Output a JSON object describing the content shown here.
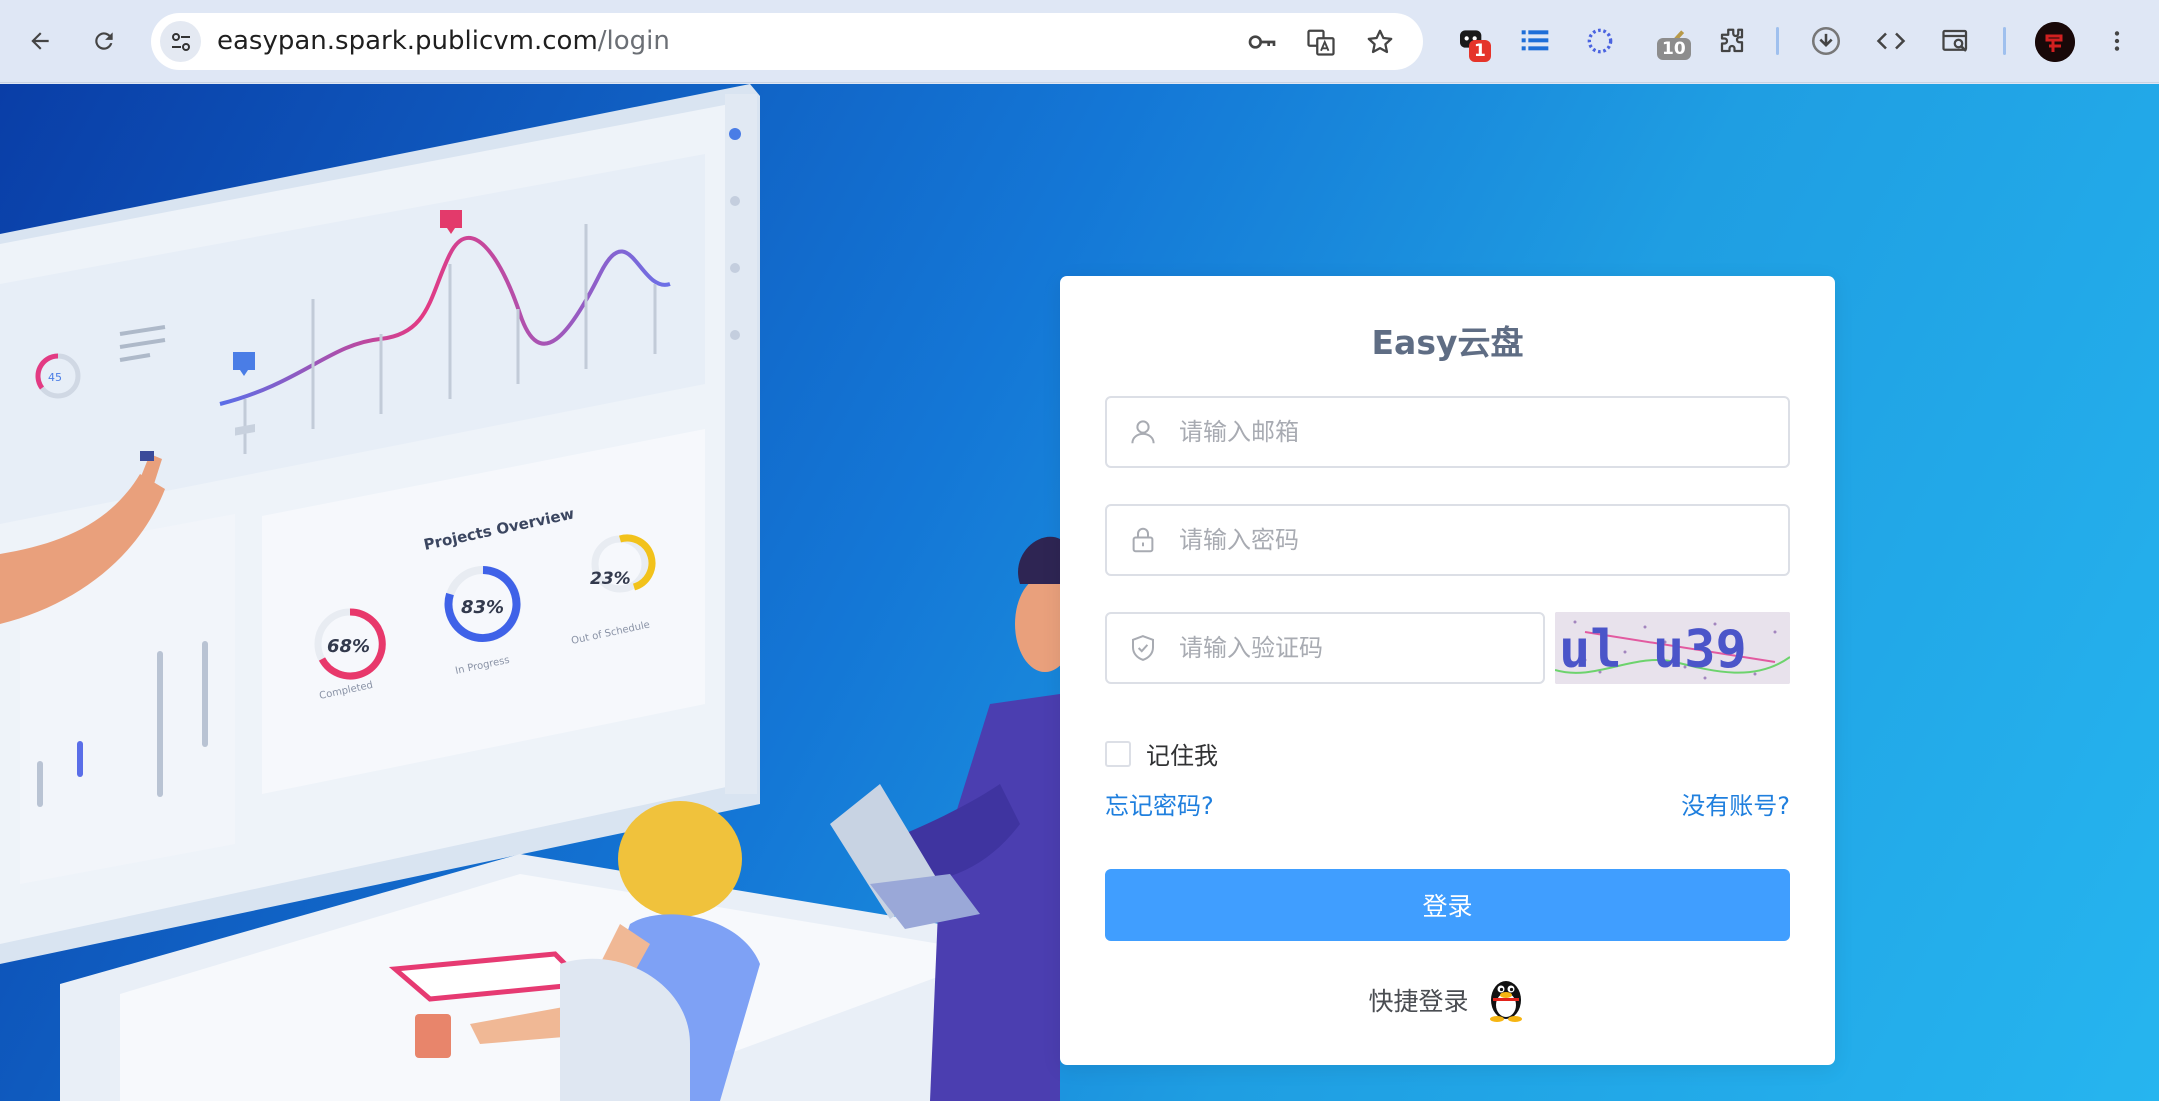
{
  "browser": {
    "url_host": "easypan.spark.publicvm.com",
    "url_path": "/login",
    "extensions": [
      {
        "name": "ext-chat",
        "badge": "1",
        "badge_color": "#e5342a"
      },
      {
        "name": "ext-list"
      },
      {
        "name": "ext-circle"
      },
      {
        "name": "ext-check",
        "badge": "10",
        "badge_color": "#8d8d8d"
      },
      {
        "name": "ext-puzzle"
      }
    ]
  },
  "illustration": {
    "gauge_small": "45",
    "projects_title": "Projects Overview",
    "stats": [
      {
        "value": "68%",
        "label": "Completed",
        "color": "#e8386b",
        "progress": 0.68
      },
      {
        "value": "83%",
        "label": "In Progress",
        "color": "#3f62e8",
        "progress": 0.83
      },
      {
        "value": "23%",
        "label": "Out of Schedule",
        "color": "#f2c21b",
        "progress": 0.23
      }
    ]
  },
  "login": {
    "title": "Easy云盘",
    "email_placeholder": "请输入邮箱",
    "password_placeholder": "请输入密码",
    "captcha_placeholder": "请输入验证码",
    "captcha_text": "ul u39",
    "remember_label": "记住我",
    "forgot_link": "忘记密码?",
    "register_link": "没有账号?",
    "submit_label": "登录",
    "quick_login_label": "快捷登录"
  },
  "colors": {
    "primary": "#409eff",
    "link": "#1f7fde",
    "title": "#5f6d84"
  }
}
